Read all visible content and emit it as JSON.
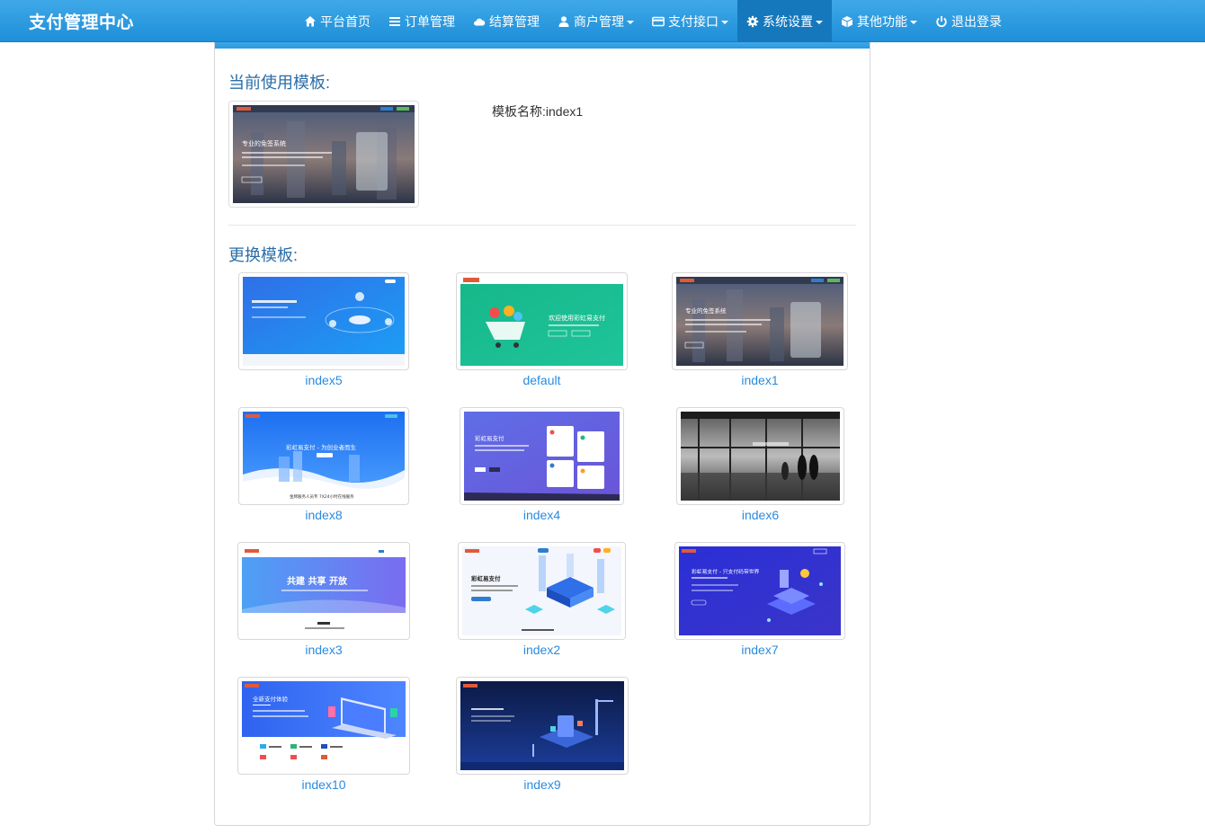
{
  "brand": "支付管理中心",
  "nav": [
    {
      "label": "平台首页",
      "icon": "home-icon",
      "dropdown": false
    },
    {
      "label": "订单管理",
      "icon": "list-icon",
      "dropdown": false
    },
    {
      "label": "结算管理",
      "icon": "cloud-icon",
      "dropdown": false
    },
    {
      "label": "商户管理",
      "icon": "user-icon",
      "dropdown": true
    },
    {
      "label": "支付接口",
      "icon": "credit-card-icon",
      "dropdown": true
    },
    {
      "label": "系统设置",
      "icon": "gear-icon",
      "dropdown": true,
      "active": true
    },
    {
      "label": "其他功能",
      "icon": "cube-icon",
      "dropdown": true
    },
    {
      "label": "退出登录",
      "icon": "power-icon",
      "dropdown": false
    }
  ],
  "current": {
    "title": "当前使用模板:",
    "name_label": "模板名称:",
    "name_value": "index1",
    "thumb_text": "专业的免签系统"
  },
  "change": {
    "title": "更换模板:",
    "templates": [
      {
        "name": "index5",
        "style": "blue-orbit"
      },
      {
        "name": "default",
        "style": "green-cart",
        "text": "欢迎使用彩虹易支付"
      },
      {
        "name": "index1",
        "style": "city-dusk",
        "text": "专业的免签系统"
      },
      {
        "name": "index8",
        "style": "blue-wave",
        "text": "彩虹易支付 - 为创业者而生",
        "footer": "金牌服务人员专 7X24小时在线服务"
      },
      {
        "name": "index4",
        "style": "purple-cards",
        "text": "彩虹易支付"
      },
      {
        "name": "index6",
        "style": "bw-office"
      },
      {
        "name": "index3",
        "style": "purple-gradient",
        "text": "共建 共享 开放"
      },
      {
        "name": "index2",
        "style": "isometric-server",
        "text": "彩虹易支付"
      },
      {
        "name": "index7",
        "style": "deep-blue-iso",
        "text": "彩虹易支付 - 只支付码带世界"
      },
      {
        "name": "index10",
        "style": "laptop-pay",
        "text": "全新支付体验"
      },
      {
        "name": "index9",
        "style": "navy-city"
      }
    ]
  },
  "colors": {
    "nav": "#2b98de",
    "active": "#1578bd",
    "link": "#2a8be0",
    "title": "#2a6ea8"
  }
}
